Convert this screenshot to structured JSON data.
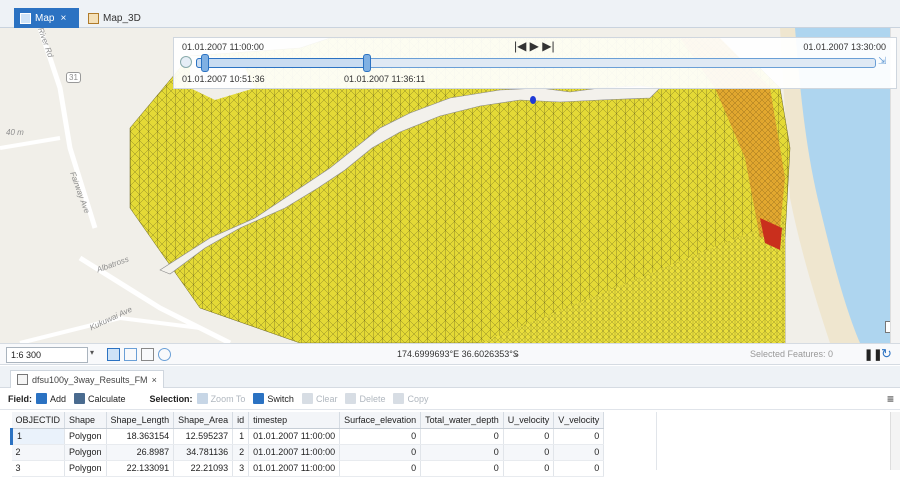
{
  "tabs": {
    "map": {
      "label": "Map",
      "close": "×"
    },
    "map3d": {
      "label": "Map_3D"
    }
  },
  "map_labels": {
    "road1": "River Rd",
    "route": "31",
    "elev": "40 m",
    "fairway": "Fairway Ave",
    "albatross": "Albatross",
    "kukuwai": "Kukuwai Ave"
  },
  "time_slider": {
    "current_start": "01.01.2007 11:00:00",
    "end": "01.01.2007 13:30:00",
    "range_start": "01.01.2007 10:51:36",
    "range_end": "01.01.2007 11:36:11",
    "controls": "|◀ ▶ ▶|"
  },
  "statusbar": {
    "scale": "1:6 300",
    "coordinates": "174.6999693°E 36.6026353°S",
    "selected_features": "Selected Features: 0"
  },
  "table": {
    "tab_label": "dfsu100y_3way_Results_FM",
    "toolbar": {
      "field_label": "Field:",
      "add": "Add",
      "calculate": "Calculate",
      "selection_label": "Selection:",
      "zoom_to": "Zoom To",
      "switch": "Switch",
      "clear": "Clear",
      "delete": "Delete",
      "copy": "Copy"
    },
    "columns": [
      "OBJECTID",
      "Shape",
      "Shape_Length",
      "Shape_Area",
      "id",
      "timestep",
      "Surface_elevation",
      "Total_water_depth",
      "U_velocity",
      "V_velocity"
    ],
    "rows": [
      [
        "1",
        "Polygon",
        "18.363154",
        "12.595237",
        "1",
        "01.01.2007 11:00:00",
        "0",
        "0",
        "0",
        "0"
      ],
      [
        "2",
        "Polygon",
        "26.8987",
        "34.781136",
        "2",
        "01.01.2007 11:00:00",
        "0",
        "0",
        "0",
        "0"
      ],
      [
        "3",
        "Polygon",
        "22.133091",
        "22.21093",
        "3",
        "01.01.2007 11:00:00",
        "0",
        "0",
        "0",
        "0"
      ]
    ]
  },
  "colors": {
    "accent": "#2b72c2",
    "mesh_yellow": "#e6dc3a",
    "mesh_orange": "#e8a030",
    "water": "#aed5ef"
  }
}
